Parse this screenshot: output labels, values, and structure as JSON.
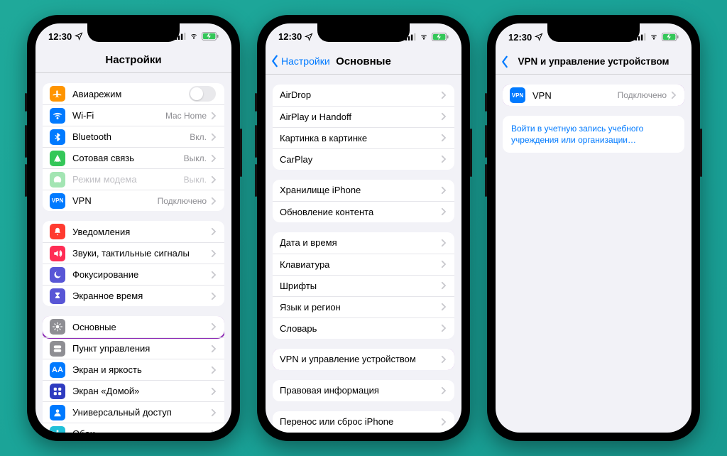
{
  "status": {
    "time": "12:30"
  },
  "phone1": {
    "title": "Настройки",
    "groups": [
      [
        {
          "id": "airplane",
          "icon": "airplane",
          "label": "Авиарежим",
          "control": "toggle",
          "color": "#ff9500"
        },
        {
          "id": "wifi",
          "icon": "wifi",
          "label": "Wi-Fi",
          "value": "Mac Home",
          "color": "#007aff"
        },
        {
          "id": "bluetooth",
          "icon": "bluetooth",
          "label": "Bluetooth",
          "value": "Вкл.",
          "color": "#007aff"
        },
        {
          "id": "cellular",
          "icon": "antenna",
          "label": "Сотовая связь",
          "value": "Выкл.",
          "color": "#34c759"
        },
        {
          "id": "hotspot",
          "icon": "hotspot",
          "label": "Режим модема",
          "value": "Выкл.",
          "color": "#34c759",
          "disabled": true
        },
        {
          "id": "vpn",
          "icon": "vpn",
          "label": "VPN",
          "value": "Подключено",
          "color": "#007aff"
        }
      ],
      [
        {
          "id": "notifications",
          "icon": "bell",
          "label": "Уведомления",
          "color": "#ff3b30"
        },
        {
          "id": "sounds",
          "icon": "speaker",
          "label": "Звуки, тактильные сигналы",
          "color": "#ff2d55"
        },
        {
          "id": "focus",
          "icon": "moon",
          "label": "Фокусирование",
          "color": "#5856d6"
        },
        {
          "id": "screentime",
          "icon": "hourglass",
          "label": "Экранное время",
          "color": "#5856d6"
        }
      ],
      [
        {
          "id": "general",
          "icon": "gear",
          "label": "Основные",
          "color": "#8e8e93",
          "highlight": true
        },
        {
          "id": "control-center",
          "icon": "switches",
          "label": "Пункт управления",
          "color": "#8e8e93"
        },
        {
          "id": "display",
          "icon": "text",
          "label": "Экран и яркость",
          "color": "#007aff"
        },
        {
          "id": "home",
          "icon": "grid",
          "label": "Экран «Домой»",
          "color": "#2f3cc0"
        },
        {
          "id": "accessibility",
          "icon": "person",
          "label": "Универсальный доступ",
          "color": "#007aff"
        },
        {
          "id": "wallpaper",
          "icon": "flower",
          "label": "Обои",
          "color": "#20c0d8"
        }
      ]
    ]
  },
  "phone2": {
    "back": "Настройки",
    "title": "Основные",
    "groups": [
      [
        {
          "id": "airdrop",
          "label": "AirDrop"
        },
        {
          "id": "airplay",
          "label": "AirPlay и Handoff"
        },
        {
          "id": "pip",
          "label": "Картинка в картинке"
        },
        {
          "id": "carplay",
          "label": "CarPlay"
        }
      ],
      [
        {
          "id": "storage",
          "label": "Хранилище iPhone"
        },
        {
          "id": "background-refresh",
          "label": "Обновление контента"
        }
      ],
      [
        {
          "id": "datetime",
          "label": "Дата и время"
        },
        {
          "id": "keyboard",
          "label": "Клавиатура"
        },
        {
          "id": "fonts",
          "label": "Шрифты"
        },
        {
          "id": "language-region",
          "label": "Язык и регион"
        },
        {
          "id": "dictionary",
          "label": "Словарь"
        }
      ],
      [
        {
          "id": "vpn-device",
          "label": "VPN и управление устройством",
          "highlight": true
        }
      ],
      [
        {
          "id": "legal",
          "label": "Правовая информация"
        }
      ],
      [
        {
          "id": "reset",
          "label": "Перенос или сброс iPhone"
        }
      ]
    ]
  },
  "phone3": {
    "title": "VPN и управление устройством",
    "vpn_label": "VPN",
    "vpn_value": "Подключено",
    "signin": "Войти в учетную запись учебного учреждения или организации…"
  }
}
